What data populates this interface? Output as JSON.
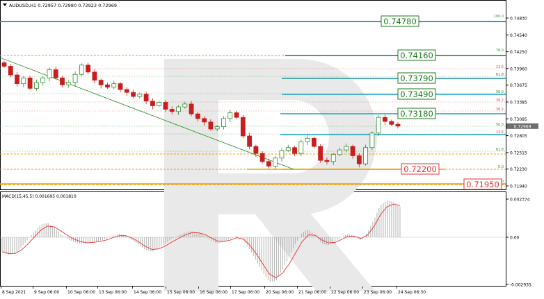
{
  "window": {
    "title": "AUDUSD,H1  0.72957 0.72980 0.72923 0.72969",
    "menu_icon": "triangle-down-icon"
  },
  "price_axis": {
    "ticks": [
      "0.74830",
      "0.74540",
      "0.74250",
      "0.73960",
      "0.73675",
      "0.73385",
      "0.73095",
      "0.72805",
      "0.72515",
      "0.72230",
      "0.71940"
    ],
    "current_price": "0.72969",
    "current_price_color": "#6e6e6e"
  },
  "macd": {
    "label": "MACD(15,45,5)  0.001695  0.001810",
    "ticks": [
      "0.002374",
      "0.00",
      "-0.002935"
    ],
    "signal_color": "#e8312f",
    "histogram_color": "#b0b0b0"
  },
  "time_axis": {
    "labels": [
      "8 Sep 2021",
      "9 Sep 06:00",
      "10 Sep 06:00",
      "13 Sep 06:00",
      "14 Sep 06:00",
      "15 Sep 06:00",
      "16 Sep 06:00",
      "17 Sep 06:00",
      "20 Sep 06:00",
      "21 Sep 06:00",
      "22 Sep 06:00",
      "23 Sep 06:00",
      "24 Sep 06:30"
    ]
  },
  "levels": [
    {
      "price": "0.74780",
      "style": "box-green",
      "line": "cyan",
      "fib": "100.0"
    },
    {
      "price": "0.74160",
      "style": "box-green",
      "line": "dark-green",
      "fib": "76.0"
    },
    {
      "price": "0.73790",
      "style": "box-green",
      "line": "teal",
      "fib": ""
    },
    {
      "price": "0.73490",
      "style": "box-green",
      "line": "cyan",
      "fib": ""
    },
    {
      "price": "0.73180",
      "style": "box-green",
      "line": "cyan",
      "fib": ""
    },
    {
      "price": "0.72200",
      "style": "box-red",
      "line": "orange",
      "fib": "0.0"
    },
    {
      "price": "0.71950",
      "style": "box-red",
      "line": "orange",
      "fib": "76.0"
    }
  ],
  "fib_labels": [
    "100.0",
    "76.0",
    "23.6",
    "61.8",
    "38.2",
    "50.0",
    "38.2",
    "50.0",
    "23.6",
    "61.8",
    "0.0",
    "76.0"
  ],
  "colors": {
    "bull": "#2e8b2e",
    "bear": "#c81e1e",
    "level_green": "#1e7a1e",
    "level_red": "#e8312f",
    "cyan": "#1aa3c9",
    "orange": "#f0a000",
    "trendline": "#1e8c1e",
    "watermark": "#e8e8e8"
  },
  "chart_data": {
    "type": "candlestick",
    "symbol": "AUDUSD",
    "timeframe": "H1",
    "title": "AUDUSD,H1  0.72957 0.72980 0.72923 0.72969",
    "ylim": [
      0.719,
      0.7488
    ],
    "x_labels": [
      "8 Sep 2021",
      "9 Sep 06:00",
      "10 Sep 06:00",
      "13 Sep 06:00",
      "14 Sep 06:00",
      "15 Sep 06:00",
      "16 Sep 06:00",
      "17 Sep 06:00",
      "20 Sep 06:00",
      "21 Sep 06:00",
      "22 Sep 06:00",
      "23 Sep 06:00",
      "24 Sep 06:30"
    ],
    "close_path": [
      0.74,
      0.7385,
      0.737,
      0.738,
      0.7362,
      0.7372,
      0.738,
      0.7394,
      0.738,
      0.7368,
      0.7372,
      0.7386,
      0.7402,
      0.739,
      0.7376,
      0.7368,
      0.7364,
      0.737,
      0.736,
      0.7355,
      0.7348,
      0.7352,
      0.734,
      0.7332,
      0.7338,
      0.7326,
      0.7322,
      0.733,
      0.7335,
      0.7318,
      0.731,
      0.7304,
      0.7292,
      0.7296,
      0.731,
      0.732,
      0.7312,
      0.728,
      0.7262,
      0.725,
      0.7236,
      0.7228,
      0.7242,
      0.7255,
      0.726,
      0.725,
      0.727,
      0.7276,
      0.7262,
      0.7238,
      0.7236,
      0.7248,
      0.7256,
      0.7262,
      0.7246,
      0.7232,
      0.726,
      0.7285,
      0.7312,
      0.7305,
      0.73,
      0.7297
    ],
    "horizontal_levels": [
      0.7478,
      0.7416,
      0.7379,
      0.7349,
      0.7318,
      0.722,
      0.7195
    ],
    "macd": {
      "params": "15,45,5",
      "main": 0.001695,
      "signal": 0.00181,
      "range": [
        -0.002935,
        0.002374
      ],
      "histogram": [
        -0.0009,
        -0.0011,
        -0.001,
        -0.0006,
        -0.0001,
        0.0004,
        0.0008,
        0.0009,
        0.0006,
        0.0002,
        -0.0001,
        -0.0003,
        -0.0004,
        -0.0004,
        -0.0003,
        -0.0002,
        -0.0001,
        0.0001,
        0.0002,
        0.0001,
        -0.0002,
        -0.0005,
        -0.0008,
        -0.0009,
        -0.0007,
        -0.0004,
        -0.0001,
        0.0001,
        0.0003,
        0.0004,
        0.0003,
        0.0001,
        -0.0002,
        -0.0004,
        -0.0003,
        -0.0001,
        0.0001,
        -0.0002,
        -0.0008,
        -0.0015,
        -0.0022,
        -0.0028,
        -0.0027,
        -0.002,
        -0.0012,
        -0.0004,
        0.0003,
        0.0005,
        0.0001,
        -0.0004,
        -0.0005,
        -0.0003,
        0.0,
        0.0002,
        0.0001,
        -0.0002,
        0.0003,
        0.0011,
        0.002,
        0.0023,
        0.0022,
        0.0019
      ]
    }
  }
}
